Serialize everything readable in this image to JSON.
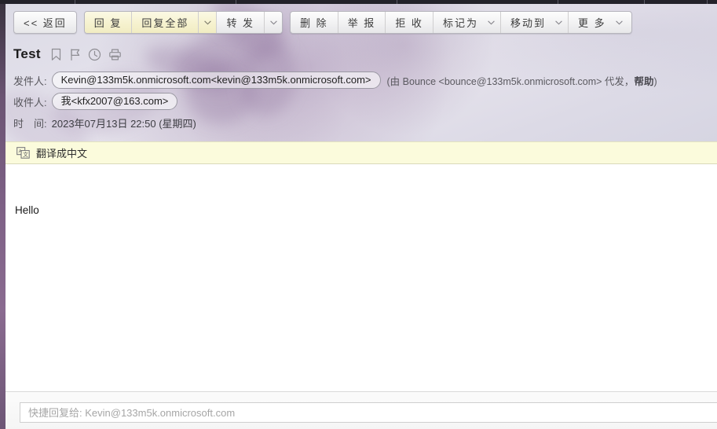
{
  "window": {
    "tab_separator_positions": [
      95,
      300,
      505,
      710,
      820,
      900
    ]
  },
  "toolbar": {
    "groups": [
      {
        "name": "back-group",
        "style": "gray",
        "buttons": [
          {
            "name": "back-button",
            "label": "<< 返回",
            "icon": null,
            "caret": false,
            "style": "gray"
          }
        ]
      },
      {
        "name": "reply-group",
        "style": "mixed",
        "buttons": [
          {
            "name": "reply-button",
            "label": "回 复",
            "caret": false,
            "style": "yellow"
          },
          {
            "name": "reply-all-button",
            "label": "回复全部",
            "caret": false,
            "style": "yellow"
          },
          {
            "name": "reply-all-caret",
            "label": "",
            "caret": true,
            "style": "yellow"
          },
          {
            "name": "forward-button",
            "label": "转 发",
            "caret": false,
            "style": "gray"
          },
          {
            "name": "forward-caret",
            "label": "",
            "caret": true,
            "style": "gray"
          }
        ]
      },
      {
        "name": "action-group",
        "style": "gray",
        "buttons": [
          {
            "name": "delete-button",
            "label": "删 除",
            "caret": false,
            "style": "gray"
          },
          {
            "name": "report-button",
            "label": "举 报",
            "caret": false,
            "style": "gray"
          },
          {
            "name": "reject-button",
            "label": "拒 收",
            "caret": false,
            "style": "gray"
          },
          {
            "name": "mark-as-button",
            "label": "标记为",
            "caret": true,
            "style": "gray"
          },
          {
            "name": "move-to-button",
            "label": "移动到",
            "caret": true,
            "style": "gray"
          },
          {
            "name": "more-button",
            "label": "更 多",
            "caret": true,
            "style": "gray"
          }
        ]
      }
    ]
  },
  "subject": {
    "title": "Test",
    "icons": [
      "bookmark-icon",
      "flag-icon",
      "clock-icon",
      "print-icon"
    ]
  },
  "meta": {
    "from_label": "发件人:",
    "from_value": "Kevin@133m5k.onmicrosoft.com<kevin@133m5k.onmicrosoft.com>",
    "from_extra_prefix": "(由 Bounce <bounce@133m5k.onmicrosoft.com> 代发，",
    "from_extra_link": "帮助",
    "from_extra_suffix": ")",
    "to_label": "收件人:",
    "to_value": "我<kfx2007@163.com>",
    "time_label": "时　间:",
    "time_value": "2023年07月13日 22:50 (星期四)"
  },
  "translate": {
    "icon": "translate-icon",
    "label": "翻译成中文"
  },
  "body": {
    "text": "Hello"
  },
  "quick_reply": {
    "placeholder": "快捷回复给: Kevin@133m5k.onmicrosoft.com"
  },
  "colors": {
    "rail": "#7e6186",
    "translate_bg": "#fbfbdc",
    "reply_btn_bg": "#f6f2cf",
    "header_bg": "#e2e0ea"
  }
}
